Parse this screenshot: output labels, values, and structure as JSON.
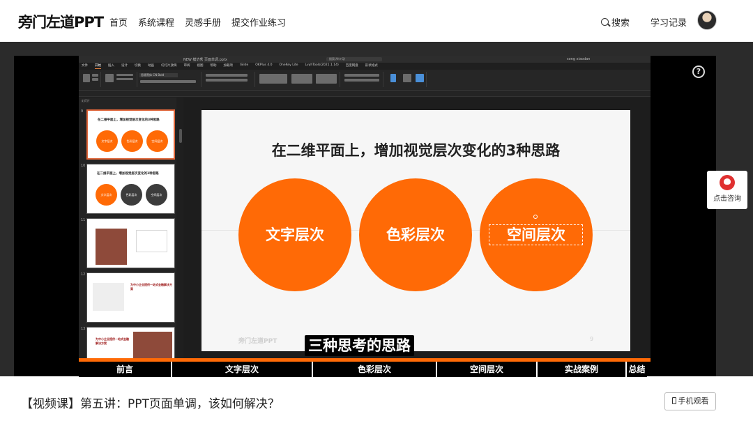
{
  "header": {
    "logo": "旁门左道PPT",
    "nav": [
      "首页",
      "系统课程",
      "灵感手册",
      "提交作业练习"
    ],
    "search_label": "搜索",
    "learning_record": "学习记录"
  },
  "player": {
    "help_glyph": "?",
    "consult_label": "点击咨询",
    "subtitle": "三种思考的思路",
    "chapters": [
      "前言",
      "文字层次",
      "色彩层次",
      "空间层次",
      "实战案例",
      "总结"
    ]
  },
  "ppt": {
    "window_title": "NEW 模仿秀  页面单调.pptx",
    "search_placeholder": "搜索(Alt+Q)",
    "user": "song xiaodan",
    "tabs": [
      "文件",
      "开始",
      "插入",
      "设计",
      "切换",
      "动画",
      "幻灯片放映",
      "审阅",
      "视图",
      "帮助",
      "加载项",
      "iSlide",
      "OKPlus 4.0",
      "OneKey Lite",
      "LvyhTools(2021.1.14)",
      "百度网盘",
      "形状格式"
    ],
    "active_tab": "开始",
    "font_name": "思源黑体 CN Bold",
    "panel_header": "幻灯片",
    "thumbnails": [
      {
        "num": "9",
        "title": "在二维平面上，增加视觉层次变化的3种思路",
        "chips": [
          "文字层次",
          "色彩层次",
          "空间层次"
        ]
      },
      {
        "num": "10",
        "title": "在二维平面上，增加视觉层次变化的3种思路",
        "chips": [
          "文字层次",
          "色彩层次",
          "空间层次"
        ]
      },
      {
        "num": "11",
        "title": "",
        "chips": []
      },
      {
        "num": "12",
        "title": "为中小企业提供一站式金融解决方案",
        "chips": []
      },
      {
        "num": "13",
        "title": "为中小企业提供一站式金融解决方案",
        "chips": []
      }
    ]
  },
  "slide": {
    "title": "在二维平面上，增加视觉层次变化的3种思路",
    "circles": [
      "文字层次",
      "色彩层次",
      "空间层次"
    ],
    "watermark": "旁门左道PPT",
    "page_number": "9"
  },
  "footer": {
    "video_title": "【视频课】第五讲：PPT页面单调，该如何解决？",
    "mobile_button": "手机观看"
  },
  "colors": {
    "accent": "#ff6a06",
    "dark_bg": "#2b2b2b"
  }
}
